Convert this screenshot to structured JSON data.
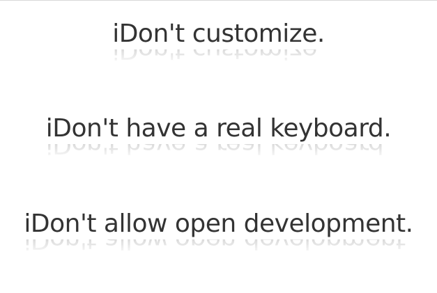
{
  "slogans": [
    {
      "text": "iDon't customize."
    },
    {
      "text": "iDon't have a real keyboard."
    },
    {
      "text": "iDon't allow open development."
    }
  ],
  "colors": {
    "background": "#ffffff",
    "text": "#333333",
    "top_border": "#d8d8d8"
  }
}
